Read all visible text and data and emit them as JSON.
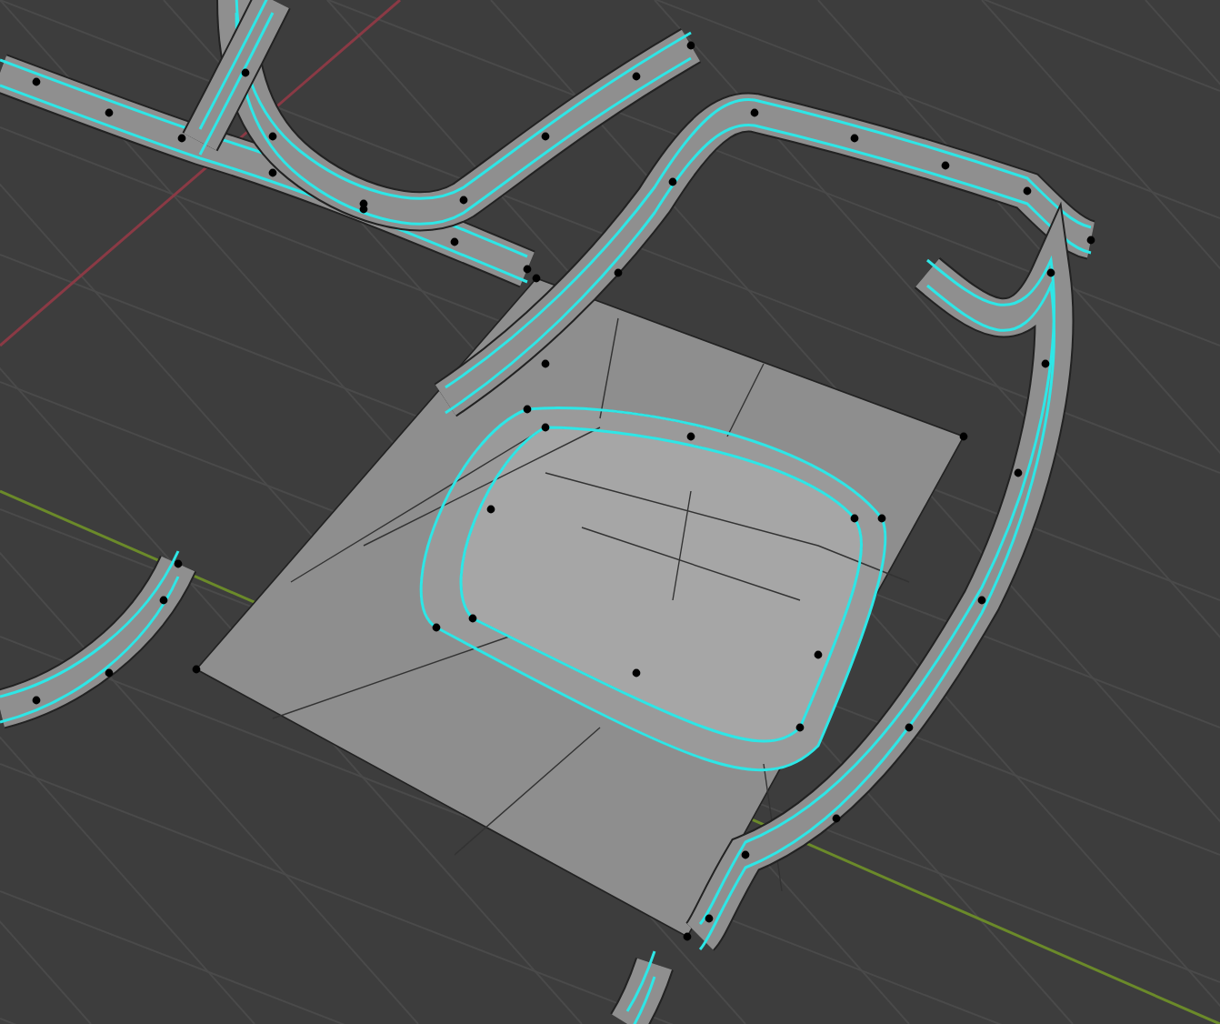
{
  "viewport": {
    "grid": true,
    "axes": true,
    "selection_outline": true
  }
}
